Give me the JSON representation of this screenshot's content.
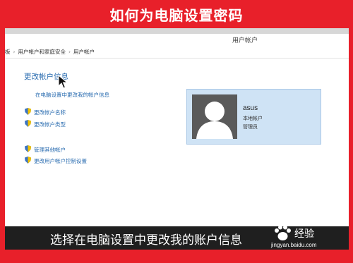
{
  "banner": {
    "title": "如何为电脑设置密码"
  },
  "window": {
    "title": "用户帐户"
  },
  "breadcrumb": [
    "板",
    "用户帐户和家庭安全",
    "用户帐户"
  ],
  "panel": {
    "heading": "更改帐户信息",
    "pc_settings_link": "在电脑设置中更改我的帐户信息",
    "links": [
      "更改帐户名称",
      "更改帐户类型"
    ],
    "links2": [
      "管理其他帐户",
      "更改用户帐户控制设置"
    ]
  },
  "user": {
    "name": "asus",
    "account_type": "本地帐户",
    "role": "管理员"
  },
  "subtitle": "选择在电脑设置中更改我的账户信息",
  "watermark": {
    "text": "经验",
    "url": "jingyan.baidu.com"
  },
  "colors": {
    "banner_bg": "#e8202a",
    "link": "#2a6cb0",
    "card_bg": "#cfe3f5"
  }
}
